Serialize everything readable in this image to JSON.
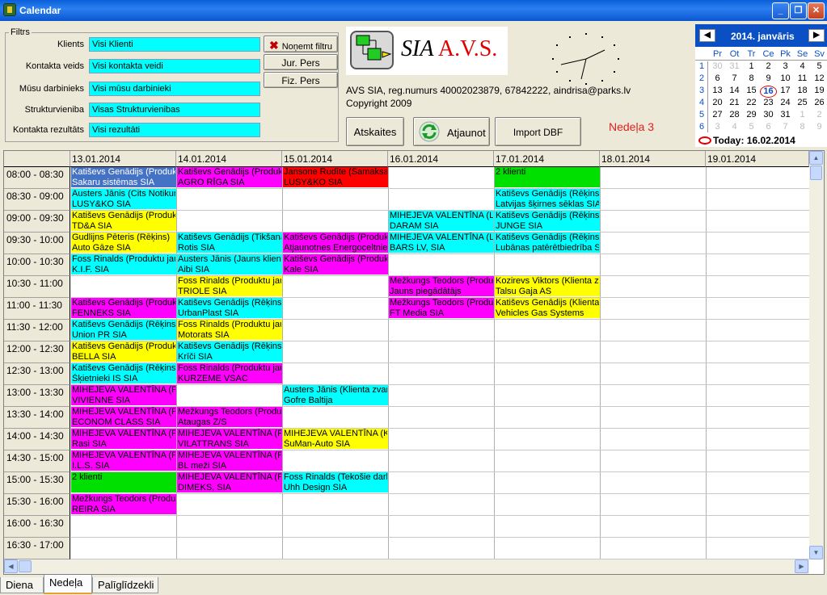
{
  "window": {
    "title": "Calendar",
    "min_glyph": "_",
    "max_glyph": "❐",
    "close_glyph": "✕"
  },
  "filters": {
    "legend": "Filtrs",
    "rows": [
      {
        "label": "Klients",
        "value": "Visi Klienti"
      },
      {
        "label": "Kontakta veids",
        "value": "Visi kontakta veidi"
      },
      {
        "label": "Mūsu darbinieks",
        "value": "Visi mūsu darbinieki"
      },
      {
        "label": "Strukturvieniba",
        "value": "Visas Strukturvienibas"
      },
      {
        "label": "Kontakta rezultāts",
        "value": "Visi rezultāti"
      }
    ],
    "clear_label": "Noņemt filtru",
    "jur_label": "Jur. Pers",
    "fiz_label": "Fiz. Pers"
  },
  "company": {
    "logo_prefix": "SIA",
    "logo_name": "A.V.S.",
    "info": "AVS SIA, reg.numurs 40002023879, 67842222, aindrisa@parks.lv",
    "copyright": "Copyright 2009"
  },
  "toolbar": {
    "reports_label": "Atskaites",
    "refresh_label": "Atjaunot",
    "import_label": "Import DBF",
    "week_label": "Nedeļa 3"
  },
  "minicalendar": {
    "title": "2014. janvāris",
    "prev_glyph": "◀",
    "next_glyph": "▶",
    "dows": [
      "Pr",
      "Ot",
      "Tr",
      "Ce",
      "Pk",
      "Se",
      "Sv"
    ],
    "weeks": [
      {
        "wk": "1",
        "days": [
          "30",
          "31",
          "1",
          "2",
          "3",
          "4",
          "5"
        ],
        "gray": [
          0,
          1
        ]
      },
      {
        "wk": "2",
        "days": [
          "6",
          "7",
          "8",
          "9",
          "10",
          "11",
          "12"
        ],
        "gray": []
      },
      {
        "wk": "3",
        "days": [
          "13",
          "14",
          "15",
          "16",
          "17",
          "18",
          "19"
        ],
        "gray": []
      },
      {
        "wk": "4",
        "days": [
          "20",
          "21",
          "22",
          "23",
          "24",
          "25",
          "26"
        ],
        "gray": []
      },
      {
        "wk": "5",
        "days": [
          "27",
          "28",
          "29",
          "30",
          "31",
          "1",
          "2"
        ],
        "gray": [
          5,
          6
        ]
      },
      {
        "wk": "6",
        "days": [
          "3",
          "4",
          "5",
          "6",
          "7",
          "8",
          "9"
        ],
        "gray": [
          0,
          1,
          2,
          3,
          4,
          5,
          6
        ]
      }
    ],
    "circled_day": "16",
    "today_label": "Today: 16.02.2014"
  },
  "calendar": {
    "colors": {
      "blue": "#4472c4",
      "magenta": "#ff00ff",
      "red": "#ff0000",
      "green": "#00e000",
      "cyan": "#00ffff",
      "yellow": "#ffff00"
    },
    "dates": [
      "13.01.2014",
      "14.01.2014",
      "15.01.2014",
      "16.01.2014",
      "17.01.2014",
      "18.01.2014",
      "19.01.2014"
    ],
    "times": [
      "08:00 - 08:30",
      "08:30 - 09:00",
      "09:00 - 09:30",
      "09:30 - 10:00",
      "10:00 - 10:30",
      "10:30 - 11:00",
      "11:00 - 11:30",
      "11:30 - 12:00",
      "12:00 - 12:30",
      "12:30 - 13:00",
      "13:00 - 13:30",
      "13:30 - 14:00",
      "14:00 - 14:30",
      "14:30 - 15:00",
      "15:00 - 15:30",
      "15:30 - 16:00",
      "16:00 - 16:30",
      "16:30 - 17:00"
    ],
    "appointments": [
      {
        "day": 0,
        "slot": 0,
        "color": "blue",
        "line1": "Katiševs Genādijs (Produktu",
        "line2": "Sakaru sistēmas SIA"
      },
      {
        "day": 1,
        "slot": 0,
        "color": "magenta",
        "line1": "Katiševs Genādijs (Produktu",
        "line2": "AGRO RĪGA SIA"
      },
      {
        "day": 2,
        "slot": 0,
        "color": "red",
        "line1": "Jansone Rudīte (Samaksa)",
        "line2": "LUSY&KO SIA"
      },
      {
        "day": 4,
        "slot": 0,
        "color": "green",
        "line1": "2 klienti",
        "line2": ""
      },
      {
        "day": 0,
        "slot": 1,
        "color": "cyan",
        "line1": "Austers Jānis (Cits Notikums",
        "line2": "LUSY&KO SIA"
      },
      {
        "day": 4,
        "slot": 1,
        "color": "cyan",
        "line1": "Katiševs Genādijs (Rēķins)",
        "line2": "Latvijas šķirnes sēklas SIA"
      },
      {
        "day": 0,
        "slot": 2,
        "color": "yellow",
        "line1": "Katiševs Genādijs (Produktu",
        "line2": "TD&A SIA"
      },
      {
        "day": 3,
        "slot": 2,
        "color": "cyan",
        "line1": "MIHEJEVA VALENTĪNA (Li",
        "line2": "DARAM SIA"
      },
      {
        "day": 4,
        "slot": 2,
        "color": "cyan",
        "line1": "Katiševs Genādijs (Rēķins)",
        "line2": "JUNGE SIA"
      },
      {
        "day": 0,
        "slot": 3,
        "color": "yellow",
        "line1": "Gudlijns Pēteris (Rēķins)",
        "line2": "Auto Gāze SIA"
      },
      {
        "day": 1,
        "slot": 3,
        "color": "cyan",
        "line1": "Katiševs Genādijs (Tikšanā",
        "line2": "Rotis SIA"
      },
      {
        "day": 2,
        "slot": 3,
        "color": "magenta",
        "line1": "Katiševs Genādijs (Produkt",
        "line2": "Atjaunotnes Energoceltnieks"
      },
      {
        "day": 3,
        "slot": 3,
        "color": "cyan",
        "line1": "MIHEJEVA VALENTĪNA (Li",
        "line2": "BARS LV, SIA"
      },
      {
        "day": 4,
        "slot": 3,
        "color": "cyan",
        "line1": "Katiševs Genādijs (Rēķins)",
        "line2": "Lubānas patērētbiedrība SI"
      },
      {
        "day": 0,
        "slot": 4,
        "color": "cyan",
        "line1": "Foss Rinalds (Produktu jaur",
        "line2": "K.I.F. SIA"
      },
      {
        "day": 1,
        "slot": 4,
        "color": "cyan",
        "line1": "Austers Jānis (Jauns klients",
        "line2": "Aibi SIA"
      },
      {
        "day": 2,
        "slot": 4,
        "color": "magenta",
        "line1": "Katiševs Genādijs (Produkt",
        "line2": "Kale SIA"
      },
      {
        "day": 1,
        "slot": 5,
        "color": "yellow",
        "line1": "Foss Rinalds (Produktu jaur",
        "line2": "TRIOLE SIA"
      },
      {
        "day": 3,
        "slot": 5,
        "color": "magenta",
        "line1": "Mežkungs Teodors (Produk",
        "line2": "Jauns piegādātājs"
      },
      {
        "day": 4,
        "slot": 5,
        "color": "yellow",
        "line1": "Kozirevs Viktors (Klienta zva",
        "line2": "Talsu Gaja AS"
      },
      {
        "day": 0,
        "slot": 6,
        "color": "magenta",
        "line1": "Katiševs Genādijs (Produkt",
        "line2": "FENNEKS SIA"
      },
      {
        "day": 1,
        "slot": 6,
        "color": "cyan",
        "line1": "Katiševs Genādijs (Rēķins)",
        "line2": "UrbanPlast SIA"
      },
      {
        "day": 3,
        "slot": 6,
        "color": "magenta",
        "line1": "Mežkungs Teodors (Produk",
        "line2": "FT Media SIA"
      },
      {
        "day": 4,
        "slot": 6,
        "color": "yellow",
        "line1": "Katiševs Genādijs (Klienta z",
        "line2": "Vehicles Gas Systems"
      },
      {
        "day": 0,
        "slot": 7,
        "color": "cyan",
        "line1": "Katiševs Genādijs (Rēķins)",
        "line2": "Union PR SIA"
      },
      {
        "day": 1,
        "slot": 7,
        "color": "yellow",
        "line1": "Foss Rinalds (Produktu jaur",
        "line2": "Motorats SIA"
      },
      {
        "day": 0,
        "slot": 8,
        "color": "yellow",
        "line1": "Katiševs Genādijs (Produkt",
        "line2": "BELLA SIA"
      },
      {
        "day": 1,
        "slot": 8,
        "color": "cyan",
        "line1": "Katiševs Genādijs (Rēķins)",
        "line2": "Krīči SIA"
      },
      {
        "day": 0,
        "slot": 9,
        "color": "cyan",
        "line1": "Katiševs Genādijs (Rēķins)",
        "line2": "Šķietnieki IS SIA"
      },
      {
        "day": 1,
        "slot": 9,
        "color": "magenta",
        "line1": "Foss Rinalds (Produktu jaur",
        "line2": "KURZEME VSAC"
      },
      {
        "day": 0,
        "slot": 10,
        "color": "magenta",
        "line1": "MIHEJEVA VALENTĪNA (P",
        "line2": "VIVIENNE SIA"
      },
      {
        "day": 2,
        "slot": 10,
        "color": "cyan",
        "line1": "Austers Jānis (Klienta zvans",
        "line2": "Gofre Baltija"
      },
      {
        "day": 0,
        "slot": 11,
        "color": "magenta",
        "line1": "MIHEJEVA VALENTĪNA (P",
        "line2": "ECONOM CLASS SIA"
      },
      {
        "day": 1,
        "slot": 11,
        "color": "magenta",
        "line1": "Mežkungs Teodors (Produk",
        "line2": "Ataugas Z/S"
      },
      {
        "day": 0,
        "slot": 12,
        "color": "magenta",
        "line1": "MIHEJEVA VALENTĪNA (P",
        "line2": "Rasi SIA"
      },
      {
        "day": 1,
        "slot": 12,
        "color": "magenta",
        "line1": "MIHEJEVA VALENTĪNA (P",
        "line2": "VILATTRANS SIA"
      },
      {
        "day": 2,
        "slot": 12,
        "color": "yellow",
        "line1": "MIHEJEVA VALENTĪNA (K",
        "line2": "ŠuMan-Auto SIA"
      },
      {
        "day": 0,
        "slot": 13,
        "color": "magenta",
        "line1": "MIHEJEVA VALENTĪNA (P",
        "line2": "I.L.S. SIA"
      },
      {
        "day": 1,
        "slot": 13,
        "color": "magenta",
        "line1": "MIHEJEVA VALENTĪNA (P",
        "line2": "BL meži SIA"
      },
      {
        "day": 0,
        "slot": 14,
        "color": "green",
        "line1": "2 klienti",
        "line2": ""
      },
      {
        "day": 1,
        "slot": 14,
        "color": "magenta",
        "line1": "MIHEJEVA VALENTĪNA (P",
        "line2": "DIMEKS, SIA"
      },
      {
        "day": 2,
        "slot": 14,
        "color": "cyan",
        "line1": "Foss Rinalds (Tekošie darbi",
        "line2": "Uhh Design SIA"
      },
      {
        "day": 0,
        "slot": 15,
        "color": "magenta",
        "line1": "Mežkungs Teodors (Produk",
        "line2": "REIRA SIA"
      }
    ]
  },
  "tabs": [
    {
      "label": "Diena",
      "active": false
    },
    {
      "label": "Nedeļa",
      "active": true
    },
    {
      "label": "Palīglīdzekli",
      "active": false
    }
  ]
}
